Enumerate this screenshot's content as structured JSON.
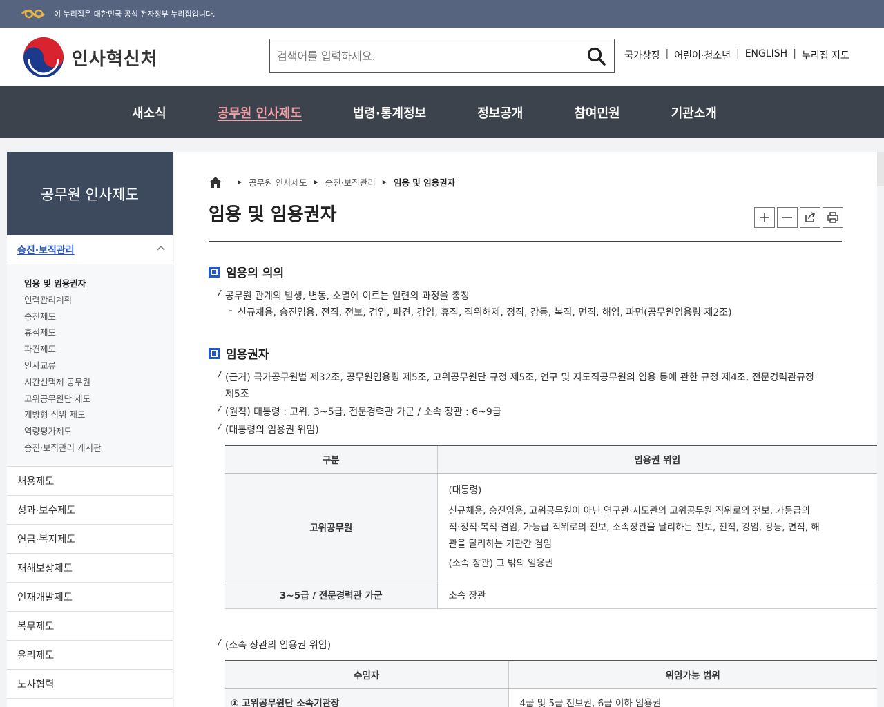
{
  "gov_bar": {
    "text": "이 누리집은 대한민국 공식 전자정부 누리집입니다."
  },
  "header": {
    "logo_text": "인사혁신처",
    "search_placeholder": "검색어를 입력하세요.",
    "util_links": [
      "국가상징",
      "어린이·청소년",
      "ENGLISH",
      "누리집 지도"
    ]
  },
  "gnb": {
    "items": [
      "새소식",
      "공무원 인사제도",
      "법령·통계정보",
      "정보공개",
      "참여민원",
      "기관소개"
    ],
    "active_index": 1
  },
  "sidebar": {
    "title": "공무원 인사제도",
    "active_group": "승진·보직관리",
    "subitems": [
      "임용 및 임용권자",
      "인력관리계획",
      "승진제도",
      "휴직제도",
      "파견제도",
      "인사교류",
      "시간선택제 공무원",
      "고위공무원단 제도",
      "개방형 직위 제도",
      "역량평가제도",
      "승진·보직관리 게시판"
    ],
    "current_sub_index": 0,
    "groups": [
      "채용제도",
      "성과·보수제도",
      "연금·복지제도",
      "재해보상제도",
      "인재개발제도",
      "복무제도",
      "윤리제도",
      "노사협력"
    ]
  },
  "breadcrumb": [
    "공무원 인사제도",
    "승진·보직관리",
    "임용 및 임용권자"
  ],
  "page_title": "임용 및 임용권자",
  "sections": {
    "s1": {
      "heading": "임용의 의의",
      "line1": "공무원 관계의 발생, 변동, 소멸에 이르는 일련의 과정을 총칭",
      "line2": "신규채용, 승진임용, 전직, 전보, 겸임, 파견, 강임, 휴직, 직위해제, 정직, 강등, 복직, 면직, 해임, 파면(공무원임용령 제2조)"
    },
    "s2": {
      "heading": "임용권자",
      "basis_1": "(근거) 국가공무원법 제32조, 공무원임용령 제5조, 고위공무원단 규정 제5조, 연구 및 지도직공무원의 임용 등에 관한 규정 제4조, 전문경력관규정",
      "basis_2": "제5조",
      "principle": "(원칙) 대통령 : 고위, 3~5급, 전문경력관 가군 / 소속 장관 : 6~9급",
      "delegation": "(대통령의 임용권 위임)",
      "table1": {
        "headers": [
          "구분",
          "임용권 위임"
        ],
        "row1_label": "고위공무원",
        "row1_lines": [
          "(대통령)",
          "신규채용, 승진임용, 고위공무원이 아닌 연구관·지도관의 고위공무원 직위로의 전보, 가등급의",
          "직·정직·복직·겸임, 가등급 직위로의 전보, 소속장관을 달리하는 전보, 전직, 강임, 강등, 면직, 해",
          "관을 달리하는 기관간 겸임",
          "(소속 장관) 그 밖의 임용권"
        ],
        "row2_label": "3~5급 / 전문경력관 가군",
        "row2_value": "소속 장관"
      },
      "minister_delegation": "(소속 장관의 임용권 위임)",
      "table2": {
        "headers": [
          "수임자",
          "위임가능 범위"
        ],
        "row1_label": "① 고위공무원단 소속기관장",
        "row1_value": "4급 및 5급 전보권, 6급 이하 임용권"
      }
    }
  }
}
